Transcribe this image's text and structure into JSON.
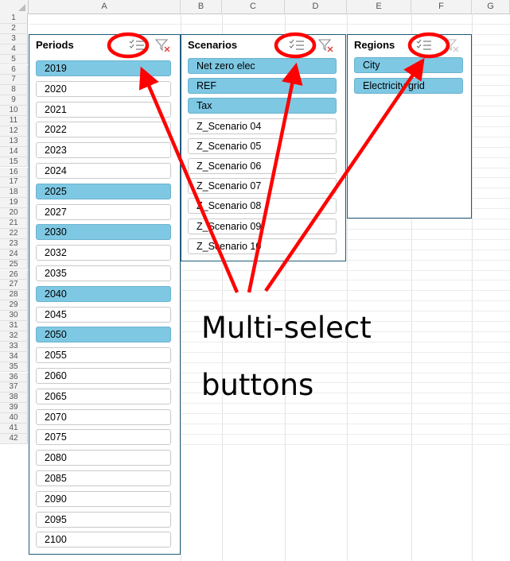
{
  "columns": [
    "A",
    "B",
    "C",
    "D",
    "E",
    "F",
    "G"
  ],
  "rows": [
    "1",
    "2",
    "3",
    "4",
    "5",
    "6",
    "7",
    "8",
    "9",
    "10",
    "11",
    "12",
    "13",
    "14",
    "15",
    "16",
    "17",
    "18",
    "19",
    "20",
    "21",
    "22",
    "23",
    "24",
    "25",
    "26",
    "27",
    "28",
    "29",
    "30",
    "31",
    "32",
    "33",
    "34",
    "35",
    "36",
    "37",
    "38",
    "39",
    "40",
    "41",
    "42"
  ],
  "slicers": {
    "periods": {
      "title": "Periods",
      "multiselect_icon": "multi-select-icon",
      "clear_icon": "clear-filter-icon",
      "items": [
        {
          "label": "2019",
          "selected": true
        },
        {
          "label": "2020",
          "selected": false
        },
        {
          "label": "2021",
          "selected": false
        },
        {
          "label": "2022",
          "selected": false
        },
        {
          "label": "2023",
          "selected": false
        },
        {
          "label": "2024",
          "selected": false
        },
        {
          "label": "2025",
          "selected": true
        },
        {
          "label": "2027",
          "selected": false
        },
        {
          "label": "2030",
          "selected": true
        },
        {
          "label": "2032",
          "selected": false
        },
        {
          "label": "2035",
          "selected": false
        },
        {
          "label": "2040",
          "selected": true
        },
        {
          "label": "2045",
          "selected": false
        },
        {
          "label": "2050",
          "selected": true
        },
        {
          "label": "2055",
          "selected": false
        },
        {
          "label": "2060",
          "selected": false
        },
        {
          "label": "2065",
          "selected": false
        },
        {
          "label": "2070",
          "selected": false
        },
        {
          "label": "2075",
          "selected": false
        },
        {
          "label": "2080",
          "selected": false
        },
        {
          "label": "2085",
          "selected": false
        },
        {
          "label": "2090",
          "selected": false
        },
        {
          "label": "2095",
          "selected": false
        },
        {
          "label": "2100",
          "selected": false
        }
      ]
    },
    "scenarios": {
      "title": "Scenarios",
      "multiselect_icon": "multi-select-icon",
      "clear_icon": "clear-filter-icon",
      "items": [
        {
          "label": "Net zero elec",
          "selected": true
        },
        {
          "label": "REF",
          "selected": true
        },
        {
          "label": "Tax",
          "selected": true
        },
        {
          "label": "Z_Scenario 04",
          "selected": false
        },
        {
          "label": "Z_Scenario 05",
          "selected": false
        },
        {
          "label": "Z_Scenario 06",
          "selected": false
        },
        {
          "label": "Z_Scenario 07",
          "selected": false
        },
        {
          "label": "Z_Scenario 08",
          "selected": false
        },
        {
          "label": "Z_Scenario 09",
          "selected": false
        },
        {
          "label": "Z_Scenario 10",
          "selected": false
        }
      ]
    },
    "regions": {
      "title": "Regions",
      "multiselect_icon": "multi-select-icon",
      "clear_icon": "clear-filter-icon",
      "items": [
        {
          "label": "City",
          "selected": true
        },
        {
          "label": "Electricity grid",
          "selected": true
        }
      ]
    }
  },
  "annotation": {
    "line1": "Multi-select",
    "line2": "buttons",
    "color": "#ff0000"
  },
  "colors": {
    "selected_item": "#7ec8e3",
    "slicer_border": "#1f5b7a"
  }
}
